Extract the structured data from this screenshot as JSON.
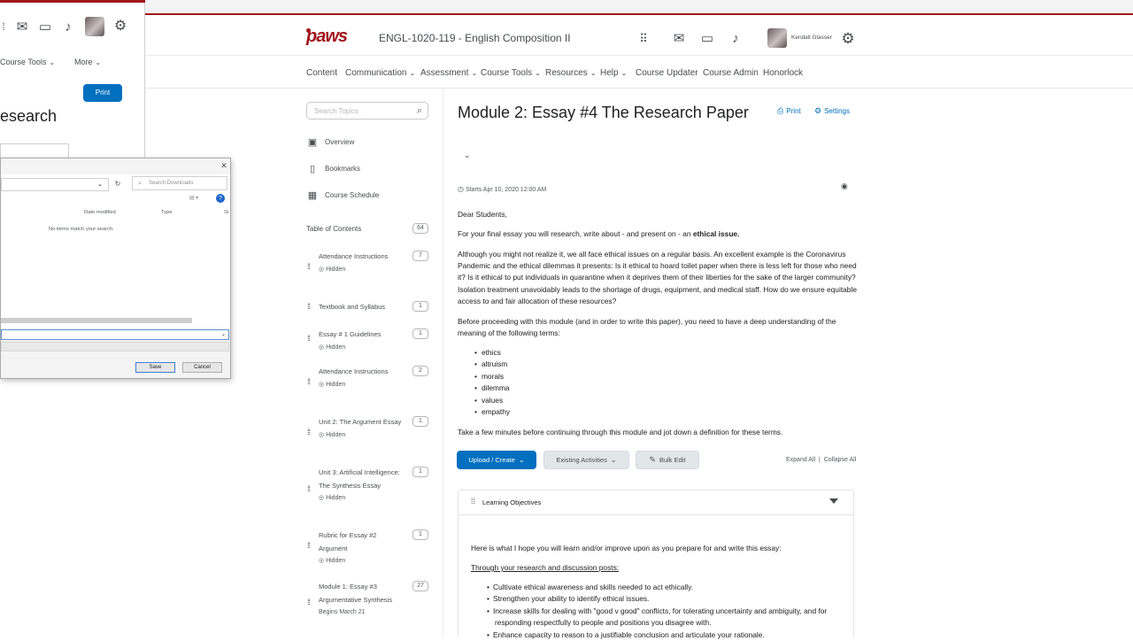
{
  "header": {
    "logo_text": "paws",
    "course_title": "ENGL-1020-119 - English Composition II",
    "user_name": "Kendall Glasser"
  },
  "nav": {
    "items": [
      "Content",
      "Communication",
      "Assessment",
      "Course Tools",
      "Resources",
      "Help",
      "Course Updater",
      "Course Admin",
      "Honorlock"
    ]
  },
  "sidebar": {
    "search_placeholder": "Search Topics",
    "links": [
      "Overview",
      "Bookmarks",
      "Course Schedule"
    ],
    "toc_label": "Table of Contents",
    "toc_count": "64",
    "items": [
      {
        "title": "Attendance Instructions",
        "count": "7",
        "status": "Hidden"
      },
      {
        "title": "Textbook and Syllabus",
        "count": "1",
        "status": ""
      },
      {
        "title": "Essay # 1 Guidelines",
        "count": "1",
        "status": "Hidden"
      },
      {
        "title": "Attendance Instructions",
        "count": "2",
        "status": "Hidden"
      },
      {
        "title": "Unit 2: The Argument Essay",
        "count": "1",
        "status": "Hidden"
      },
      {
        "title": "Unit 3: Artificial Intelligence: The Synthesis Essay",
        "count": "1",
        "status": "Hidden"
      },
      {
        "title": "Rubric for Essay #2 Argument",
        "count": "1",
        "status": "Hidden"
      },
      {
        "title": "Module 1: Essay #3 Argumentative Synthesis",
        "count": "27",
        "status": "Begins March 21"
      }
    ]
  },
  "main": {
    "title": "Module 2: Essay #4 The Research Paper",
    "print_label": "Print",
    "settings_label": "Settings",
    "start_text": "Starts Apr 10, 2020 12:00 AM",
    "greeting": "Dear Students,",
    "intro_prefix": "For your final essay you will research, write about - and present on - an ",
    "intro_bold": "ethical issue.",
    "para2": "Although you might not realize it, we all face ethical issues on a regular basis. An excellent example is the Coronavirus Pandemic and the ethical dilemmas it presents:   Is it ethical to hoard toilet paper when there is less left for those who need it? Is it ethical to put individuals in quarantine when it deprives them of their liberties for the sake of the larger community? Isolation treatment unavoidably leads to the shortage of drugs, equipment, and medical staff. How do we ensure equitable access to and fair allocation of these resources?",
    "para3": "Before proceeding with this module (and in order to write this paper), you need to have a deep understanding of the meaning of the following terms:",
    "terms": [
      "ethics",
      "altruism",
      "morals",
      "dilemma",
      "values",
      "empathy"
    ],
    "para4": "Take a few minutes before continuing through this module and jot down a definition for these terms.",
    "upload_label": "Upload / Create",
    "existing_label": "Existing Activities",
    "bulk_label": "Bulk Edit",
    "expand_all": "Expand All",
    "collapse_all": "Collapse All",
    "lo_title": "Learning Objectives",
    "lo_intro": "Here is what I hope you will learn and/or improve upon as you prepare for and write this essay:",
    "lo_subhead": "Through your research and discussion posts:",
    "lo_items": [
      "Cultivate ethical awareness and skills needed to act ethically.",
      "Strengthen your ability to identify ethical issues.",
      "Increase skills for dealing with \"good v good\" conflicts, for tolerating uncertainty and ambiguity, and for responding respectfully to people and positions you disagree with.",
      "Enhance capacity to reason to a justifiable conclusion and articulate your rationale."
    ]
  },
  "bg_window": {
    "course_tools": "Course Tools",
    "more": "More",
    "print": "Print",
    "heading": "esearch"
  },
  "dialog": {
    "search_placeholder": "Search Downloads",
    "col_date": "Date modified",
    "col_type": "Type",
    "col_size": "Si",
    "empty_text": "No items match your search.",
    "save": "Save",
    "cancel": "Cancel"
  },
  "colors": {
    "brand_red": "#a0151c",
    "primary_blue": "#006fbf"
  }
}
